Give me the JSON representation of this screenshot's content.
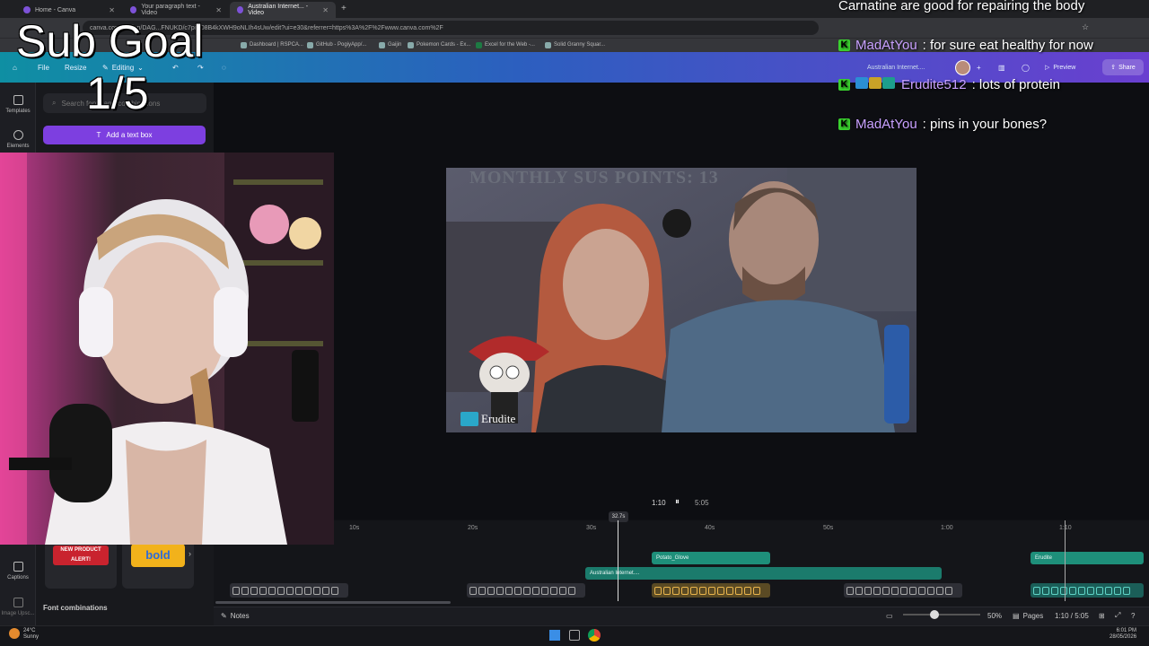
{
  "browser": {
    "tabs": [
      {
        "label": "Home - Canva",
        "active": false
      },
      {
        "label": "Your paragraph text - Video",
        "active": false
      },
      {
        "label": "Australian Internet... - Video",
        "active": true
      }
    ],
    "url": "canva.com/design/DAG...FNUKD/c7piG08B4kXWH9oNLIh4sUw/edit?ui=e30&referrer=https%3A%2F%2Fwww.canva.com%2F",
    "bookmarks": [
      "Dashboard | RSPCA...",
      "GitHub - PogiyApp/...",
      "Gaijin",
      "Pokemon Cards - Ex...",
      "Excel for the Web -...",
      "Solid Granny Squar..."
    ]
  },
  "toolbar": {
    "file_label": "File",
    "resize_label": "Resize",
    "editing_label": "Editing",
    "doc_title": "Australian Internet....",
    "preview_label": "Preview",
    "share_label": "Share"
  },
  "rail": {
    "items": [
      "Templates",
      "Elements",
      "Captions",
      "Image Upsc..."
    ]
  },
  "panel": {
    "search_placeholder": "Search fonts and combinations",
    "add_text_label": "Add a text box",
    "font_combinations_label": "Font combinations",
    "card_labels": [
      "NEW PRODUCT ALERT!",
      "bold"
    ]
  },
  "overlay": {
    "subgoal_title": "Sub Goal",
    "subgoal_value": "1/5"
  },
  "chat": {
    "partial_line": "Carnatine are good for repairing the body",
    "messages": [
      {
        "user": "MadAtYou",
        "text": ": for sure eat healthy for now",
        "badges": []
      },
      {
        "user": "Erudite512",
        "text": ": lots of protein",
        "badges": [
          "#2a8fd4",
          "#c9a227",
          "#1d9e8c"
        ]
      },
      {
        "user": "MadAtYou",
        "text": ": pins in your bones?",
        "badges": []
      }
    ]
  },
  "video": {
    "overlay_text": "MONTHLY SUS POINTS: 13",
    "watermark": "Erudite"
  },
  "playback": {
    "current": "1:10",
    "total": "5:05",
    "playhead_badge": "32.7s"
  },
  "timeline": {
    "ticks": [
      "10s",
      "20s",
      "30s",
      "40s",
      "50s",
      "1:00",
      "1:10"
    ],
    "clips": [
      {
        "label": "Potato_Glove",
        "color": "#1e8f7a"
      },
      {
        "label": "Erudite",
        "color": "#1e8f7a"
      },
      {
        "label": "Australian Internet....",
        "color": "#1b7b6c"
      }
    ]
  },
  "bottombar": {
    "notes_label": "Notes",
    "zoom_value": "50%",
    "zoom_fraction": 0.5,
    "pages_label": "Pages",
    "page_time": "1:10 / 5:05"
  },
  "taskbar": {
    "weather_temp": "24°C",
    "weather_desc": "Sunny",
    "time": "6:01 PM",
    "date": "28/05/2026"
  }
}
